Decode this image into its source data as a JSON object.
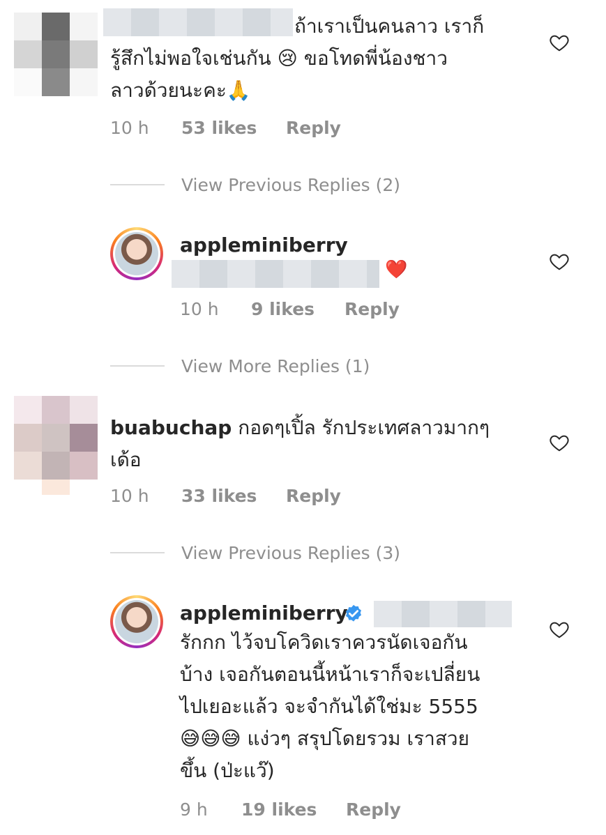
{
  "comments": [
    {
      "text_line1": "ถ้าเราเป็นคนลาว เราก็",
      "text_line2": "รู้สึกไม่พอใจเช่นกัน 😢 ขอโทดพี่น้องชาว",
      "text_line3": "ลาวด้วยนะคะ🙏",
      "time": "10 h",
      "likes": "53 likes",
      "reply": "Reply",
      "view_replies": "View Previous Replies (2)"
    },
    {
      "username": "appleminiberry",
      "emoji": "❤️",
      "time": "10 h",
      "likes": "9 likes",
      "reply": "Reply",
      "view_replies": "View More Replies (1)"
    },
    {
      "username": "buabuchap",
      "text_line1": "กอดๆเปิ้ล รักประเทศลาวมากๆ",
      "text_line2": "เด้อ",
      "time": "10 h",
      "likes": "33 likes",
      "reply": "Reply",
      "view_replies": "View Previous Replies (3)"
    },
    {
      "username": "appleminiberry",
      "text_line1": "รักกก ไว้จบโควิดเราควรนัดเจอกัน",
      "text_line2": "บ้าง เจอกันตอนนี้หน้าเราก็จะเปลี่ยน",
      "text_line3": "ไปเยอะแล้ว จะจำกันได้ใช่มะ 5555",
      "text_line4": "😅😅😅 แง่วๆ สรุปโดยรวม เราสวย",
      "text_line5": "ขึ้น (ป่ะแว๊)",
      "time": "9 h",
      "likes": "19 likes",
      "reply": "Reply"
    }
  ],
  "colors": {
    "meta_gray": "#8e8e8e",
    "text": "#262626",
    "verified": "#3897f0",
    "heart_red": "#ed4956"
  },
  "icons": [
    "heart-outline-icon",
    "verified-badge-icon",
    "red-heart-emoji"
  ]
}
